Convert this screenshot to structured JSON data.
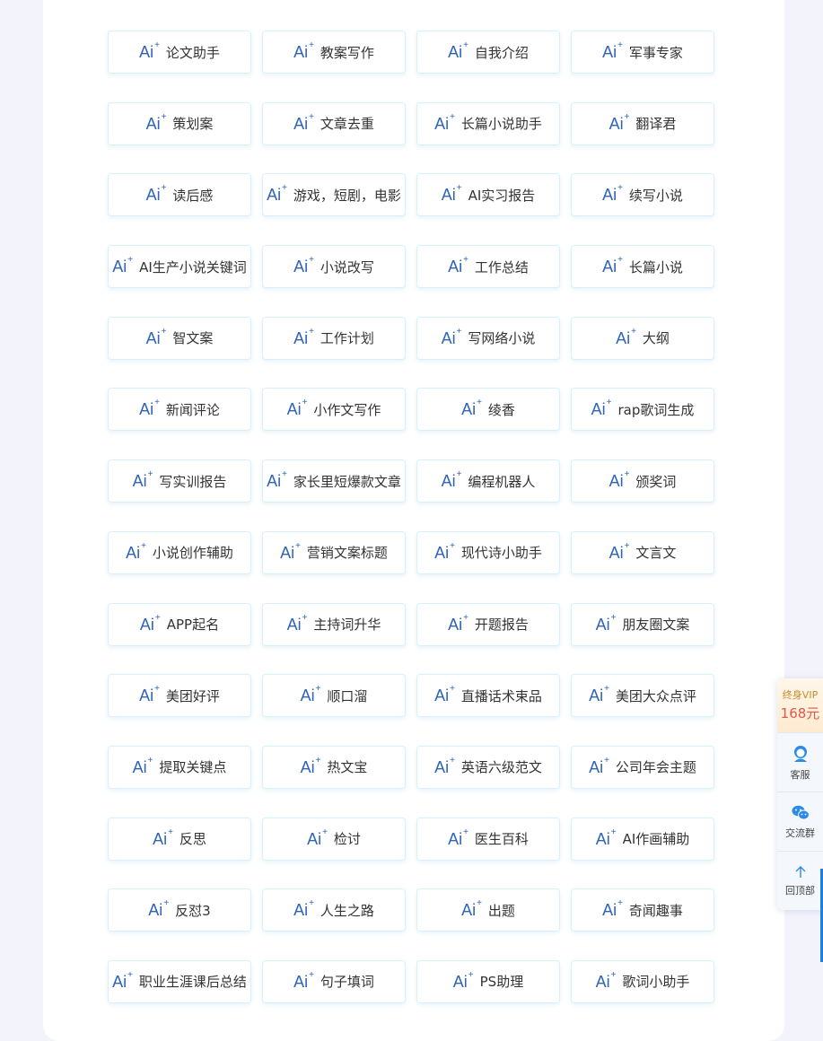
{
  "tools": [
    "论文助手",
    "教案写作",
    "自我介绍",
    "军事专家",
    "策划案",
    "文章去重",
    "长篇小说助手",
    "翻译君",
    "读后感",
    "游戏，短剧，电影",
    "AI实习报告",
    "续写小说",
    "AI生产小说关键词",
    "小说改写",
    "工作总结",
    "长篇小说",
    "智文案",
    "工作计划",
    "写网络小说",
    "大纲",
    "新闻评论",
    "小作文写作",
    "绫香",
    "rap歌词生成",
    "写实训报告",
    "家长里短爆款文章",
    "编程机器人",
    "颁奖词",
    "小说创作辅助",
    "营销文案标题",
    "现代诗小助手",
    "文言文",
    "APP起名",
    "主持词升华",
    "开题报告",
    "朋友圈文案",
    "美团好评",
    "顺口溜",
    "直播话术束品",
    "美团大众点评",
    "提取关键点",
    "热文宝",
    "英语六级范文",
    "公司年会主题",
    "反思",
    "检讨",
    "医生百科",
    "AI作画辅助",
    "反怼3",
    "人生之路",
    "出题",
    "奇闻趣事",
    "职业生涯课后总结",
    "句子填词",
    "PS助理",
    "歌词小助手"
  ],
  "ai_icon": {
    "text": "Ai",
    "spark": "+"
  },
  "sidebar": {
    "vip_label": "终身VIP",
    "vip_price": "168元",
    "service": "客服",
    "group": "交流群",
    "top": "回顶部"
  },
  "colors": {
    "accent": "#2f64b7",
    "card_border": "#d7f1fb",
    "price": "#e1574e",
    "vip_text": "#c88a2b",
    "active_bar": "#1e7fdc"
  }
}
